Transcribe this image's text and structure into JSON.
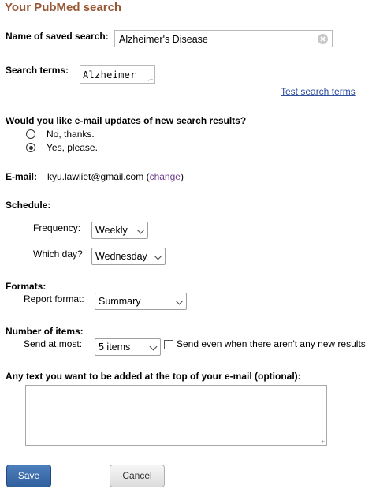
{
  "page": {
    "title": "Your PubMed search"
  },
  "name": {
    "label": "Name of saved search:",
    "value": "Alzheimer's Disease"
  },
  "search_terms": {
    "label": "Search terms:",
    "value": "Alzheimer",
    "test_link": "Test search terms"
  },
  "updates": {
    "question": "Would you like e-mail updates of new search results?",
    "options": [
      {
        "label": "No, thanks.",
        "selected": false
      },
      {
        "label": "Yes, please.",
        "selected": true
      }
    ]
  },
  "email": {
    "label": "E-mail:",
    "value": "kyu.lawliet@gmail.com",
    "open_paren": "(",
    "change_link": "change",
    "close_paren": ")"
  },
  "schedule": {
    "label": "Schedule:",
    "frequency_label": "Frequency:",
    "frequency_value": "Weekly",
    "day_label": "Which day?",
    "day_value": "Wednesday"
  },
  "formats": {
    "label": "Formats:",
    "report_label": "Report format:",
    "report_value": "Summary"
  },
  "items": {
    "label": "Number of items:",
    "send_label": "Send at most:",
    "send_value": "5 items",
    "send_even_label": "Send even when there aren't any new results",
    "send_even_checked": false
  },
  "extra_text": {
    "label": "Any text you want to be added at the top of your e-mail (optional):",
    "value": ""
  },
  "buttons": {
    "save": "Save",
    "cancel": "Cancel"
  },
  "icons": {
    "clear": "clear-icon",
    "chevron": "chevron-down-icon"
  },
  "colors": {
    "title": "#985735",
    "link": "#2f4f9e",
    "save_button": "#3a6aa8"
  }
}
